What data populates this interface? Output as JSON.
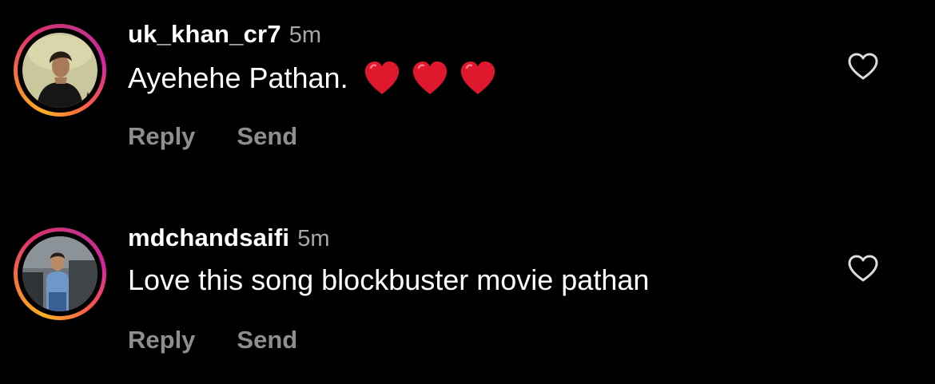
{
  "comments": [
    {
      "username": "uk_khan_cr7",
      "time": "5m",
      "text": "Ayehehe Pathan.",
      "emoji": [
        "red-heart",
        "red-heart",
        "red-heart"
      ],
      "reply_label": "Reply",
      "send_label": "Send",
      "like_icon": "heart-outline-icon"
    },
    {
      "username": "mdchandsaifi",
      "time": "5m",
      "text": "Love this song blockbuster movie pathan",
      "reply_label": "Reply",
      "send_label": "Send",
      "like_icon": "heart-outline-icon"
    }
  ],
  "colors": {
    "background": "#000000",
    "username": "#ffffff",
    "timestamp": "#a8a8a8",
    "action": "#8e8e8e",
    "heart_emoji": "#e0182d"
  }
}
